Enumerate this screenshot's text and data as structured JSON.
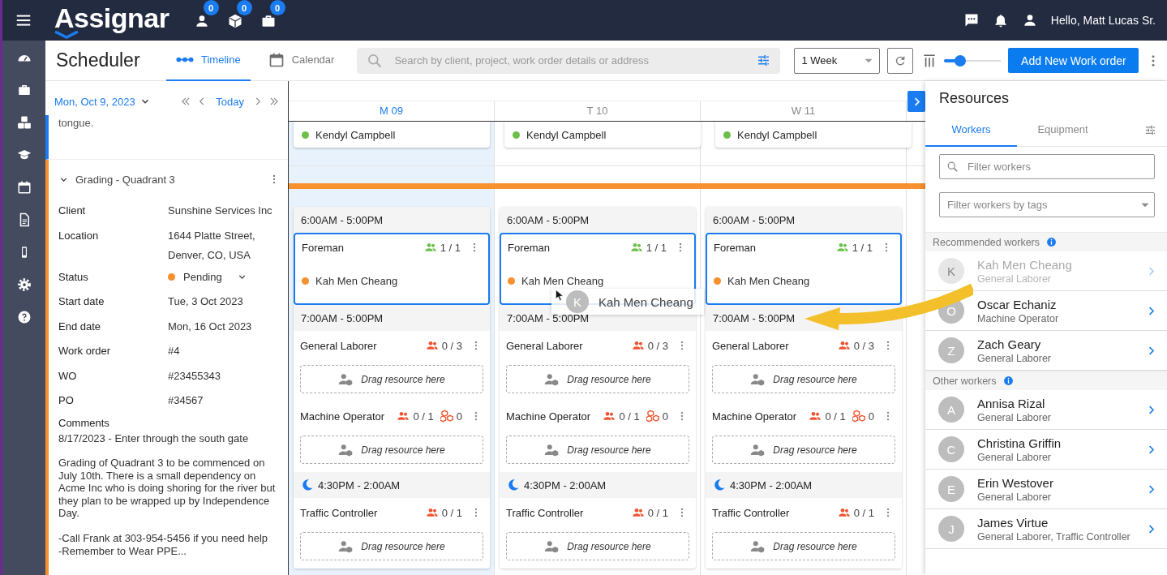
{
  "top_bar": {
    "logo": "Assignar",
    "counters": [
      {
        "kind": "person",
        "count": "0"
      },
      {
        "kind": "cube",
        "count": "0"
      },
      {
        "kind": "briefcase",
        "count": "0"
      }
    ],
    "greeting": "Hello, Matt Lucas Sr."
  },
  "nav_rail": {
    "items": [
      {
        "kind": "dashboard"
      },
      {
        "kind": "briefcase"
      },
      {
        "kind": "cubes"
      },
      {
        "kind": "cap"
      },
      {
        "kind": "calendar"
      },
      {
        "kind": "doc"
      },
      {
        "kind": "phone"
      },
      {
        "kind": "gear"
      },
      {
        "kind": "help"
      }
    ]
  },
  "toolbar": {
    "title": "Scheduler",
    "tabs": [
      {
        "label": "Timeline",
        "kind": "timeline",
        "selected": true
      },
      {
        "label": "Calendar",
        "kind": "calendar",
        "selected": false
      }
    ],
    "search": {
      "placeholder": "Search by client, project, work order details or address"
    },
    "range": "1 Week",
    "zoom": {
      "level": 0.28
    },
    "add_button": "Add New Work order"
  },
  "date_nav": {
    "date": "Mon, Oct 9, 2023",
    "today": "Today"
  },
  "work_order_panel": {
    "previous_text": "tongue.",
    "title": "Grading - Quadrant 3",
    "expanded": true,
    "fields": [
      {
        "label": "Client",
        "value": "Sunshine Services Inc"
      },
      {
        "label": "Location",
        "value": "1644 Platte Street, Denver, CO, USA"
      },
      {
        "label": "Status",
        "kind": "status",
        "value": "Pending",
        "color": "#f7902f"
      },
      {
        "label": "Start date",
        "value": "Tue, 3 Oct 2023"
      },
      {
        "label": "End date",
        "value": "Mon, 16 Oct 2023"
      },
      {
        "label": "Work order",
        "value": "#4"
      },
      {
        "label": "WO",
        "value": "#23455343"
      },
      {
        "label": "PO",
        "value": "#34567"
      }
    ],
    "comments_label": "Comments",
    "comments": [
      "8/17/2023 - Enter through the south gate",
      "Grading of Quadrant 3 to be commenced on July 10th.  There is a small dependency on Acme Inc who is doing shoring for the river but they plan to be wrapped up by Independence Day.",
      "-Call Frank at 303-954-5456 if you need help\n-Remember to Wear PPE..."
    ]
  },
  "timeline": {
    "days": [
      {
        "label": "M 09",
        "selected": true,
        "worker": {
          "name": "Kendyl Campbell",
          "color": "#6cc04a"
        },
        "shifts": [
          {
            "time": "6:00AM - 5:00PM",
            "kind": "day",
            "roles": [
              {
                "name": "Foreman",
                "count": "1 / 1",
                "staffed": true,
                "selected": true,
                "assigned": [
                  {
                    "name": "Kah Men Cheang",
                    "color": "#f7902f"
                  }
                ]
              }
            ]
          },
          {
            "time": "7:00AM - 5:00PM",
            "kind": "day",
            "roles": [
              {
                "name": "General Laborer",
                "count": "0 / 3",
                "staffed": false,
                "selected": false,
                "drop_hint": "Drag resource here"
              },
              {
                "name": "Machine Operator",
                "count": "0 / 1",
                "staffed": false,
                "selected": false,
                "equipment": "0",
                "drop_hint": "Drag resource here"
              }
            ]
          },
          {
            "time": "4:30PM - 2:00AM",
            "kind": "night",
            "roles": [
              {
                "name": "Traffic Controller",
                "count": "0 / 1",
                "staffed": false,
                "selected": false,
                "drop_hint": "Drag resource here"
              }
            ]
          }
        ]
      },
      {
        "label": "T 10",
        "selected": false,
        "worker": {
          "name": "Kendyl Campbell",
          "color": "#6cc04a"
        },
        "shifts": [
          {
            "time": "6:00AM - 5:00PM",
            "kind": "day",
            "roles": [
              {
                "name": "Foreman",
                "count": "1 / 1",
                "staffed": true,
                "selected": true,
                "assigned": [
                  {
                    "name": "Kah Men Cheang",
                    "color": "#f7902f"
                  }
                ]
              }
            ]
          },
          {
            "time": "7:00AM - 5:00PM",
            "kind": "day",
            "roles": [
              {
                "name": "General Laborer",
                "count": "0 / 3",
                "staffed": false,
                "selected": false,
                "drop_hint": "Drag resource here"
              },
              {
                "name": "Machine Operator",
                "count": "0 / 1",
                "staffed": false,
                "selected": false,
                "equipment": "0",
                "drop_hint": "Drag resource here"
              }
            ]
          },
          {
            "time": "4:30PM - 2:00AM",
            "kind": "night",
            "roles": [
              {
                "name": "Traffic Controller",
                "count": "0 / 1",
                "staffed": false,
                "selected": false,
                "drop_hint": "Drag resource here"
              }
            ]
          }
        ]
      },
      {
        "label": "W 11",
        "selected": false,
        "worker": {
          "name": "Kendyl Campbell",
          "color": "#6cc04a"
        },
        "shifts": [
          {
            "time": "6:00AM - 5:00PM",
            "kind": "day",
            "roles": [
              {
                "name": "Foreman",
                "count": "1 / 1",
                "staffed": true,
                "selected": true,
                "assigned": [
                  {
                    "name": "Kah Men Cheang",
                    "color": "#f7902f"
                  }
                ]
              }
            ]
          },
          {
            "time": "7:00AM - 5:00PM",
            "kind": "day",
            "roles": [
              {
                "name": "General Laborer",
                "count": "0 / 3",
                "staffed": false,
                "selected": false,
                "drop_hint": "Drag resource here"
              },
              {
                "name": "Machine Operator",
                "count": "0 / 1",
                "staffed": false,
                "selected": false,
                "equipment": "0",
                "drop_hint": "Drag resource here"
              }
            ]
          },
          {
            "time": "4:30PM - 2:00AM",
            "kind": "night",
            "roles": [
              {
                "name": "Traffic Controller",
                "count": "0 / 1",
                "staffed": false,
                "selected": false,
                "drop_hint": "Drag resource here"
              }
            ]
          }
        ]
      }
    ]
  },
  "drag_preview": {
    "initial": "K",
    "name": "Kah Men Cheang"
  },
  "resources": {
    "title": "Resources",
    "tabs": [
      {
        "label": "Workers",
        "selected": true
      },
      {
        "label": "Equipment",
        "selected": false
      }
    ],
    "filter": {
      "placeholder": "Filter workers"
    },
    "tag_filter": {
      "placeholder": "Filter workers by tags"
    },
    "groups": [
      {
        "title": "Recommended workers",
        "workers": [
          {
            "initial": "K",
            "name": "Kah Men Cheang",
            "role": "General Laborer",
            "disabled": true
          },
          {
            "initial": "O",
            "name": "Oscar Echaniz",
            "role": "Machine Operator",
            "disabled": false
          },
          {
            "initial": "Z",
            "name": "Zach Geary",
            "role": "General Laborer",
            "disabled": false
          }
        ]
      },
      {
        "title": "Other workers",
        "workers": [
          {
            "initial": "A",
            "name": "Annisa Rizal",
            "role": "General Laborer",
            "disabled": false
          },
          {
            "initial": "C",
            "name": "Christina Griffin",
            "role": "General Laborer",
            "disabled": false
          },
          {
            "initial": "E",
            "name": "Erin Westover",
            "role": "General Laborer",
            "disabled": false
          },
          {
            "initial": "J",
            "name": "James Virtue",
            "role": "General Laborer, Traffic Controller",
            "disabled": false
          }
        ]
      }
    ]
  }
}
